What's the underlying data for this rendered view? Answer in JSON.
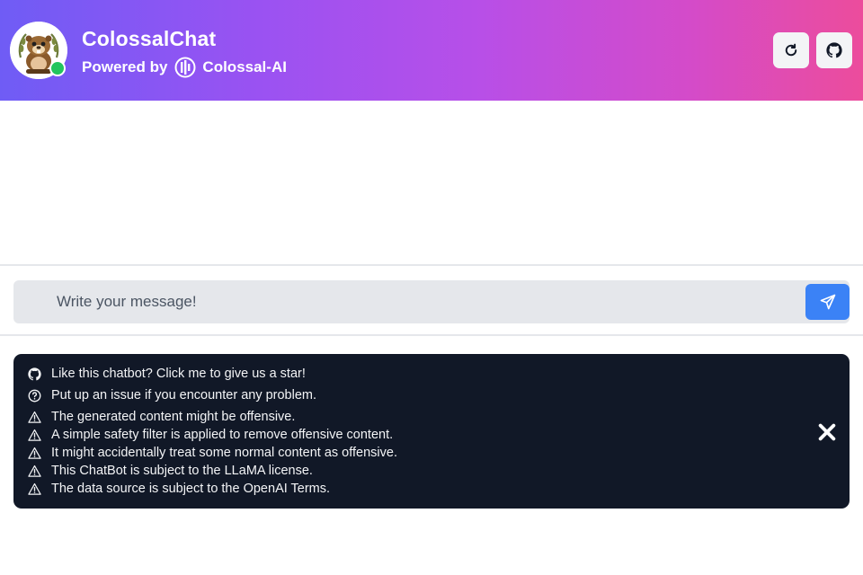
{
  "header": {
    "title": "ColossalChat",
    "powered_by": "Powered by",
    "brand": "Colossal-AI",
    "online_color": "#22c55e"
  },
  "toolbar": {
    "refresh_icon": "refresh-icon",
    "github_icon": "github-icon"
  },
  "composer": {
    "placeholder": "Write your message!",
    "value": "",
    "send_icon": "paper-plane-icon",
    "send_color": "#3b82f6"
  },
  "notice": {
    "items": [
      {
        "icon": "github-icon",
        "text": "Like this chatbot? Click me to give us a star!"
      },
      {
        "icon": "question-circle-icon",
        "text": "Put up an issue if you encounter any problem."
      },
      {
        "icon": "warning-icon",
        "text": "The generated content might be offensive."
      },
      {
        "icon": "warning-icon",
        "text": "A simple safety filter is applied to remove offensive content."
      },
      {
        "icon": "warning-icon",
        "text": "It might accidentally treat some normal content as offensive."
      },
      {
        "icon": "warning-icon",
        "text": "This ChatBot is subject to the LLaMA license."
      },
      {
        "icon": "warning-icon",
        "text": "The data source is subject to the OpenAI Terms."
      }
    ],
    "close_icon": "close-icon"
  }
}
